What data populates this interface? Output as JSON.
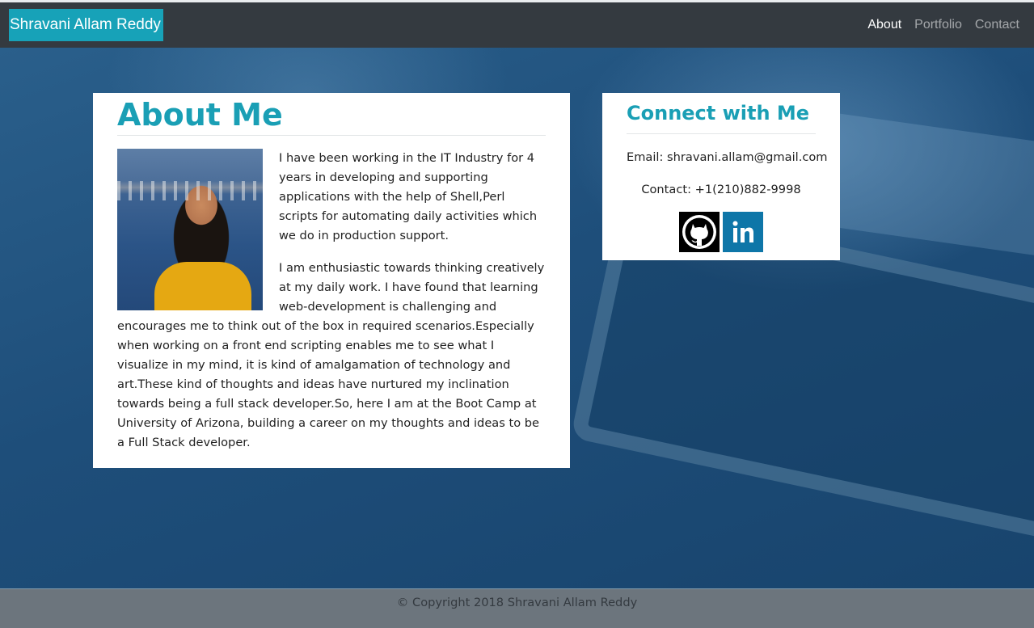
{
  "navbar": {
    "brand": "Shravani Allam Reddy",
    "links": [
      {
        "label": "About"
      },
      {
        "label": "Portfolio"
      },
      {
        "label": "Contact"
      }
    ]
  },
  "about": {
    "title": "About Me",
    "paragraphs": [
      "I have been working in the IT Industry for 4 years in developing and supporting applications with the help of Shell,Perl scripts for automating daily activities which we do in production support.",
      "I am enthusiastic towards thinking creatively at my daily work. I have found that learning web-development is challenging and encourages me to think out of the box in required scenarios.Especially when working on a front end scripting enables me to see what I visualize in my mind, it is kind of amalgamation of technology and art.These kind of thoughts and ideas have nurtured my inclination towards being a full stack developer.So, here I am at the Boot Camp at University of Arizona, building a career on my thoughts and ideas to be a Full Stack developer."
    ]
  },
  "connect": {
    "title": "Connect with Me",
    "email": "Email: shravani.allam@gmail.com",
    "contact": "Contact: +1(210)882-9998",
    "icons": [
      "github-icon",
      "linkedin-icon"
    ]
  },
  "footer": {
    "text": "© Copyright 2018 Shravani Allam Reddy"
  },
  "colors": {
    "accent": "#17a2b8",
    "navbar": "#343a40",
    "footer": "#6c757d"
  }
}
